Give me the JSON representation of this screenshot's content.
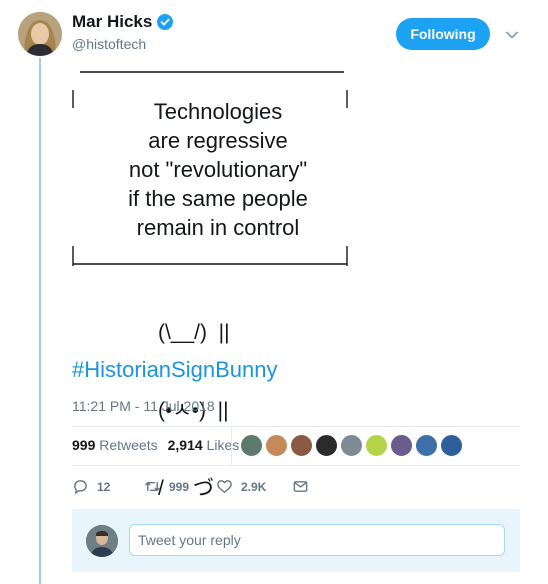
{
  "author": {
    "name": "Mar Hicks",
    "handle": "@histoftech",
    "verified": true
  },
  "follow_button": {
    "label": "Following"
  },
  "tweet": {
    "sign_top": "______________________",
    "sign_lines": [
      "Technologies",
      "are regressive",
      "not \"revolutionary\"",
      "if the same people",
      "remain in control"
    ],
    "sign_bottom": "|______________________|",
    "bunny_lines": [
      "(\\__/)  ||",
      "(•ㅅ•)  ||",
      "/     づ"
    ],
    "hashtag": "#HistorianSignBunny",
    "timestamp": "11:21 PM - 11 Jul 2018"
  },
  "stats": {
    "retweets_count": "999",
    "retweets_label": "Retweets",
    "likes_count": "2,914",
    "likes_label": "Likes"
  },
  "actions": {
    "replies": "12",
    "retweets": "999",
    "likes": "2.9K"
  },
  "reply": {
    "placeholder": "Tweet your reply"
  },
  "colors": {
    "accent": "#1da1f2",
    "hashtag": "#1b95e0",
    "muted": "#657786",
    "reply_bg": "#e8f5fd"
  },
  "icons": [
    "verified-icon",
    "chevron-down-icon",
    "reply-icon",
    "retweet-icon",
    "like-icon",
    "message-icon"
  ]
}
